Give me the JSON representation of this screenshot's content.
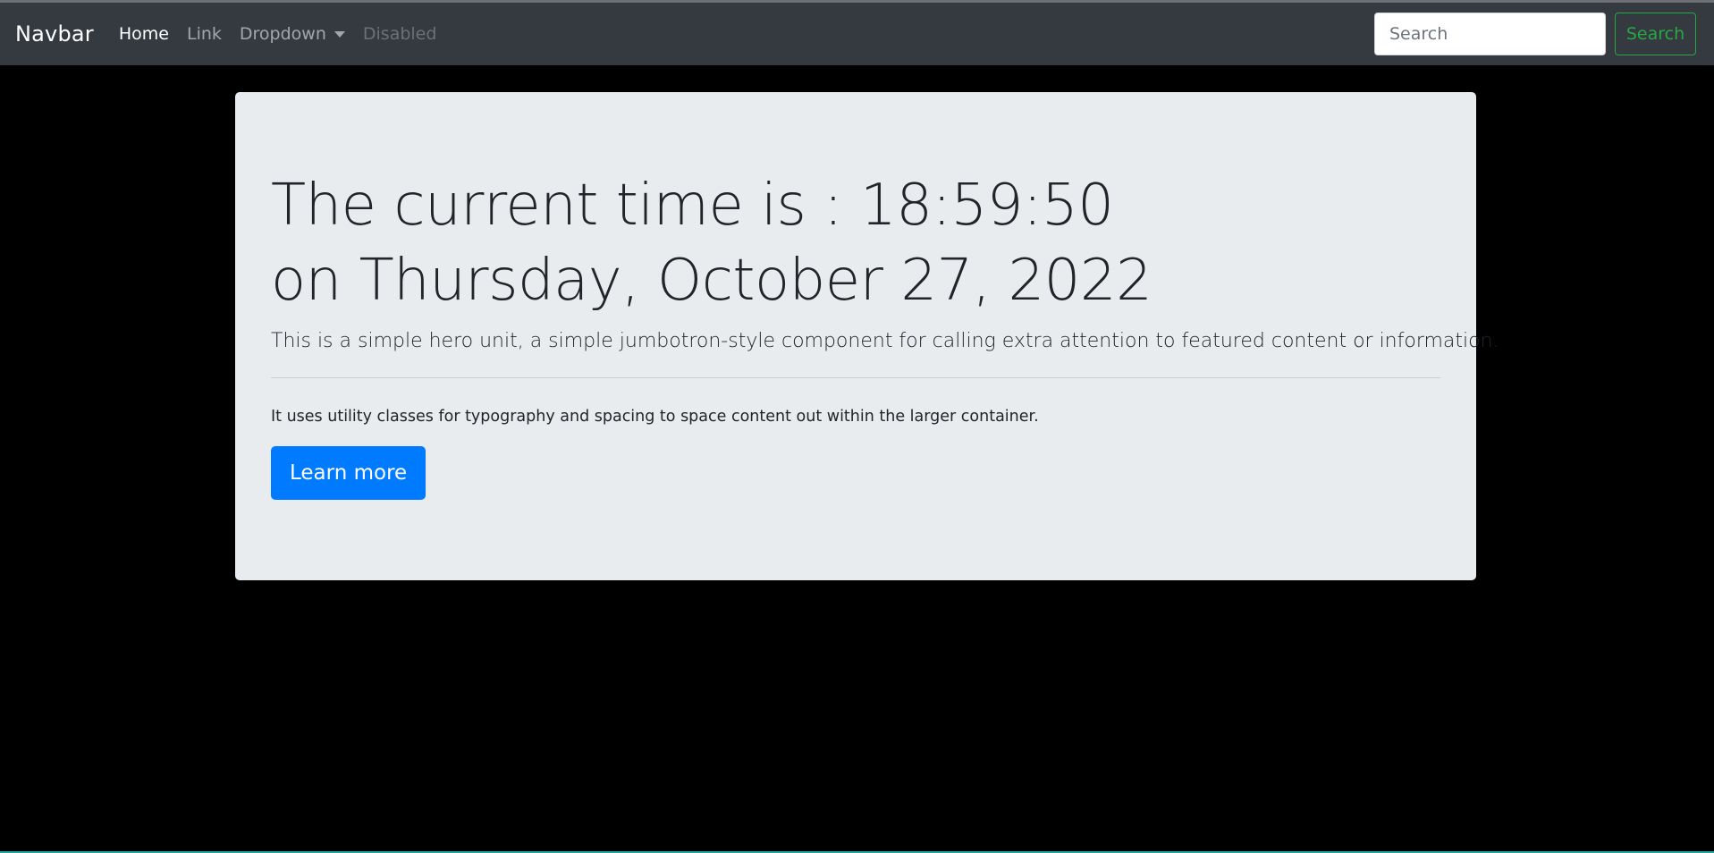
{
  "navbar": {
    "brand": "Navbar",
    "items": [
      {
        "label": "Home",
        "state": "active"
      },
      {
        "label": "Link",
        "state": "normal"
      },
      {
        "label": "Dropdown",
        "state": "normal"
      },
      {
        "label": "Disabled",
        "state": "disabled"
      }
    ],
    "search": {
      "placeholder": "Search",
      "value": "",
      "button_label": "Search"
    }
  },
  "hero": {
    "heading_line1": "The current time is : 18:59:50",
    "heading_line2": "on Thursday, October 27, 2022",
    "lead": "This is a simple hero unit, a simple jumbotron-style component for calling extra attention to featured content or information.",
    "body": "It uses utility classes for typography and spacing to space content out within the larger container.",
    "button_label": "Learn more"
  },
  "colors": {
    "navbar_bg": "#343a40",
    "page_bg": "#000000",
    "jumbotron_bg": "#e9ecef",
    "primary": "#007bff",
    "success": "#28a745"
  }
}
